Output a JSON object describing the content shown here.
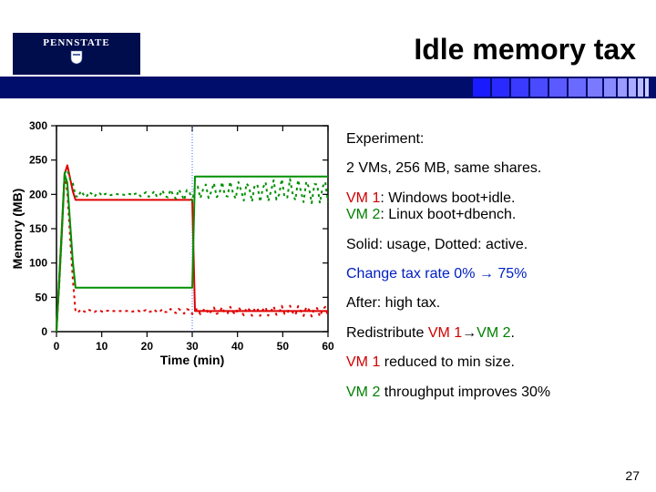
{
  "header": {
    "logo_text": "PENNSTATE",
    "title": "Idle memory tax"
  },
  "desc": {
    "l1": "Experiment:",
    "l2": "2 VMs, 256 MB, same shares.",
    "l3a": "VM 1",
    "l3b": ": Windows boot+idle.",
    "l4a": "VM 2",
    "l4b": ": Linux boot+dbench.",
    "l5": "Solid: usage, Dotted: active.",
    "l6a": "Change tax rate 0% ",
    "l6arrow": "→",
    "l6b": " 75%",
    "l7": "After: high tax.",
    "l8a": "Redistribute ",
    "l8b": "VM 1",
    "l8c": "→",
    "l8d": "VM 2",
    "l8e": ".",
    "l9a": "VM 1",
    "l9b": " reduced to min size.",
    "l10a": "VM 2",
    "l10b": " throughput improves 30%"
  },
  "slidenum": "27",
  "chart_data": {
    "type": "line",
    "title": "",
    "xlabel": "Time (min)",
    "ylabel": "Memory (MB)",
    "xlim": [
      0,
      60
    ],
    "ylim": [
      0,
      300
    ],
    "xticks": [
      0,
      10,
      20,
      30,
      40,
      50,
      60
    ],
    "yticks": [
      0,
      50,
      100,
      150,
      200,
      250,
      300
    ],
    "vline_at": 30,
    "series": [
      {
        "name": "VM1 usage (solid red)",
        "color": "#e00000",
        "style": "solid",
        "x": [
          0,
          1,
          2,
          4,
          30,
          30.5,
          60
        ],
        "y": [
          0,
          128,
          255,
          192,
          192,
          30,
          30
        ]
      },
      {
        "name": "VM1 active (dotted red)",
        "color": "#e00000",
        "style": "dotted",
        "x": [
          0,
          1,
          2,
          4,
          60
        ],
        "y": [
          0,
          120,
          250,
          30,
          30
        ],
        "jitter": 8
      },
      {
        "name": "VM2 usage (solid green)",
        "color": "#009000",
        "style": "solid",
        "x": [
          0,
          1,
          2,
          4,
          30,
          30.5,
          60
        ],
        "y": [
          0,
          128,
          255,
          64,
          64,
          226,
          226
        ]
      },
      {
        "name": "VM2 active (dotted green)",
        "color": "#009000",
        "style": "dotted",
        "x": [
          0,
          1,
          2,
          4,
          30,
          30.5,
          60
        ],
        "y": [
          0,
          120,
          250,
          200,
          200,
          205,
          205
        ],
        "jitter": 18
      }
    ]
  },
  "decor": {
    "square_colors": [
      "#1a1aff",
      "#2a2aff",
      "#3a3aff",
      "#4a4aff",
      "#5a5aff",
      "#6a6aff",
      "#7a7aff",
      "#8a8aff",
      "#9a9aff",
      "#aaaaff",
      "#bbbbff",
      "#ccccff"
    ],
    "square_widths": [
      19,
      19,
      19,
      19,
      19,
      19,
      16,
      13,
      10,
      8,
      6,
      4
    ]
  }
}
